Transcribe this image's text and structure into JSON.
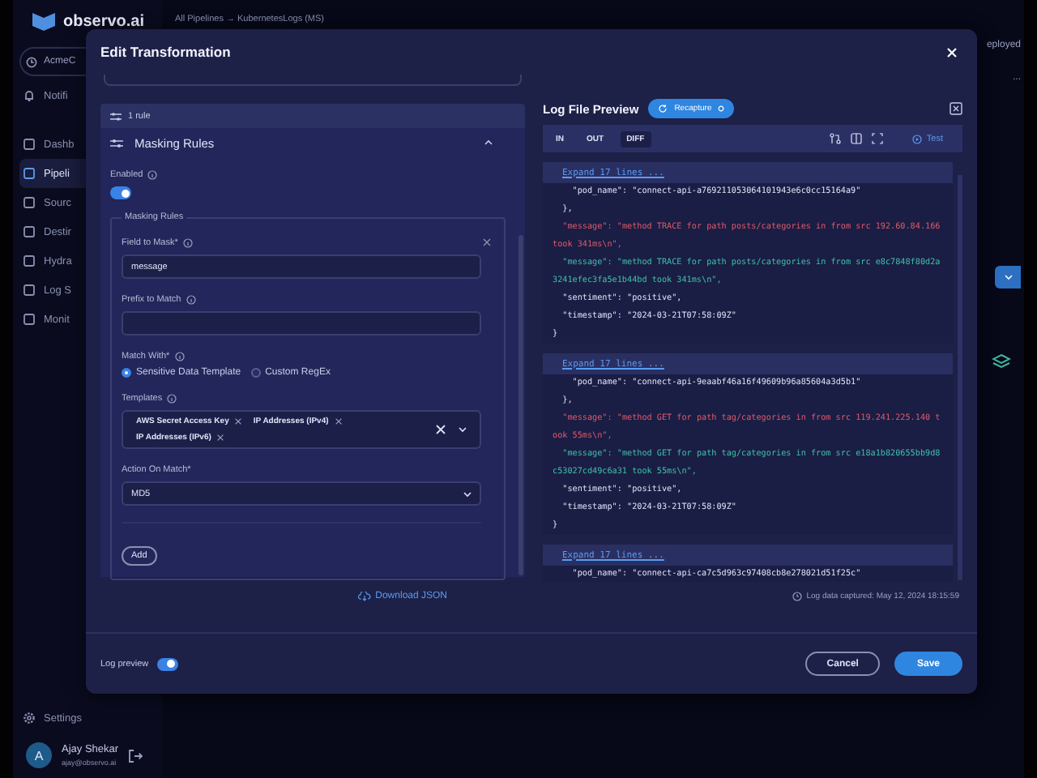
{
  "app": {
    "logo": "observo.ai",
    "breadcrumb": "All Pipelines → KubernetesLogs (MS)",
    "status": "eployed",
    "more": "..."
  },
  "sidebar": {
    "workspace": "AcmeC",
    "top_items": [
      {
        "label": "Notifi",
        "selected": false
      }
    ],
    "items": [
      {
        "label": "Dashb",
        "selected": false
      },
      {
        "label": "Pipeli",
        "selected": true
      },
      {
        "label": "Sourc",
        "selected": false
      },
      {
        "label": "Destir",
        "selected": false
      },
      {
        "label": "Hydra",
        "selected": false
      },
      {
        "label": "Log S",
        "selected": false
      },
      {
        "label": "Monit",
        "selected": false
      }
    ],
    "settings": "Settings",
    "user": {
      "initial": "A",
      "name": "Ajay Shekar",
      "email": "ajay@observo.ai"
    }
  },
  "modal": {
    "title": "Edit Transformation",
    "rule_count": "1 rule",
    "section": {
      "title": "Masking Rules",
      "expanded": true
    },
    "enabled": {
      "label": "Enabled",
      "on": true
    },
    "group": {
      "legend": "Masking Rules",
      "fields": [
        {
          "kind": "text",
          "label": "Field to Mask*",
          "info": true,
          "value": "message"
        },
        {
          "kind": "text",
          "label": "Prefix to Match",
          "info": true
        },
        {
          "kind": "radio",
          "label": "Match With*",
          "info": true,
          "options": [
            {
              "label": "Sensitive Data Template",
              "selected": true
            },
            {
              "label": "Custom RegEx",
              "selected": false
            }
          ]
        },
        {
          "kind": "multiselect",
          "label": "Templates",
          "info": true,
          "chips": [
            "AWS Secret Access Key",
            "IP Addresses (IPv4)",
            "IP Addresses (IPv6)"
          ]
        },
        {
          "kind": "select",
          "label": "Action On Match*",
          "info": false,
          "value": "MD5"
        }
      ],
      "add": "Add"
    },
    "download": "Download JSON",
    "preview": {
      "title": "Log File Preview",
      "recapture": "Recapture",
      "tabs": [
        {
          "label": "IN",
          "selected": false
        },
        {
          "label": "OUT",
          "selected": false
        },
        {
          "label": "DIFF",
          "selected": true
        }
      ],
      "test": "Test",
      "blocks": [
        {
          "expand": "Expand 17 lines ...",
          "lines": [
            {
              "kind": "context",
              "text": "    \"pod_name\": \"connect-api-a769211053064101943e6c0cc15164a9\""
            },
            {
              "kind": "context",
              "text": "  },"
            },
            {
              "kind": "removed",
              "text": "  \"message\": \"method TRACE for path posts/categories in from src 192.60.84.166 took 341ms\\n\","
            },
            {
              "kind": "added",
              "text": "  \"message\": \"method TRACE for path posts/categories in from src e8c7848f80d2a3241efec3fa5e1b44bd took 341ms\\n\","
            },
            {
              "kind": "context",
              "text": "  \"sentiment\": \"positive\","
            },
            {
              "kind": "context",
              "text": "  \"timestamp\": \"2024-03-21T07:58:09Z\""
            },
            {
              "kind": "context",
              "text": "}"
            }
          ]
        },
        {
          "expand": "Expand 17 lines ...",
          "lines": [
            {
              "kind": "context",
              "text": "    \"pod_name\": \"connect-api-9eaabf46a16f49609b96a85604a3d5b1\""
            },
            {
              "kind": "context",
              "text": "  },"
            },
            {
              "kind": "removed",
              "text": "  \"message\": \"method GET for path tag/categories in from src 119.241.225.140 took 55ms\\n\","
            },
            {
              "kind": "added",
              "text": "  \"message\": \"method GET for path tag/categories in from src e18a1b820655bb9d8c53027cd49c6a31 took 55ms\\n\","
            },
            {
              "kind": "context",
              "text": "  \"sentiment\": \"positive\","
            },
            {
              "kind": "context",
              "text": "  \"timestamp\": \"2024-03-21T07:58:09Z\""
            },
            {
              "kind": "context",
              "text": "}"
            }
          ]
        },
        {
          "expand": "Expand 17 lines ...",
          "lines": [
            {
              "kind": "context",
              "text": "    \"pod_name\": \"connect-api-ca7c5d963c97408cb8e278021d51f25c\""
            }
          ]
        }
      ],
      "captured": "Log data captured: May 12, 2024 18:15:59"
    },
    "footer": {
      "log_preview": {
        "label": "Log preview",
        "on": true
      },
      "cancel": "Cancel",
      "save": "Save"
    }
  }
}
